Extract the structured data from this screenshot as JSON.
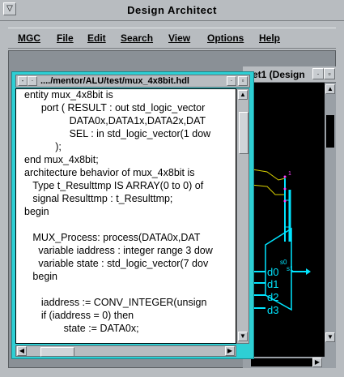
{
  "app": {
    "title": "Design Architect",
    "sys_icon": "▽"
  },
  "menu": {
    "items": [
      "MGC",
      "File",
      "Edit",
      "Search",
      "View",
      "Options",
      "Help"
    ]
  },
  "schematic_window": {
    "title": "et1 (Design",
    "pin_labels": [
      "d0",
      "d1",
      "d2",
      "d3"
    ],
    "mux_labels": [
      "s0",
      "s1"
    ],
    "wire_label": "1"
  },
  "hdl_window": {
    "title": "..../mentor/ALU/test/mux_4x8bit.hdl",
    "code_lines": [
      "entity mux_4x8bit is",
      "      port ( RESULT : out std_logic_vector",
      "                DATA0x,DATA1x,DATA2x,DAT",
      "                SEL : in std_logic_vector(1 dow",
      "           );",
      "end mux_4x8bit;",
      "architecture behavior of mux_4x8bit is",
      "   Type t_Resulttmp IS ARRAY(0 to 0) of",
      "   signal Resulttmp : t_Resulttmp;",
      "begin",
      "",
      "   MUX_Process: process(DATA0x,DAT",
      "     variable iaddress : integer range 3 dow",
      "     variable state : std_logic_vector(7 dov",
      "   begin",
      "",
      "      iaddress := CONV_INTEGER(unsign",
      "      if (iaddress = 0) then",
      "              state := DATA0x;"
    ]
  },
  "colors": {
    "accent": "#2ecfd4",
    "schematic_bg": "#000000",
    "wire": "#00e5ff",
    "yellow_wire": "#d8d000",
    "marker": "#ff44ff"
  }
}
